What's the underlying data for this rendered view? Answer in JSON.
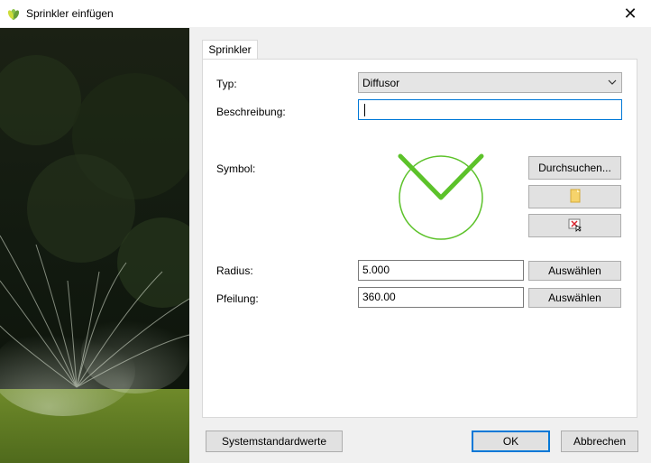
{
  "window": {
    "title": "Sprinkler einfügen",
    "close_glyph": "✕",
    "app_icon": "sprinkler-leaf-icon"
  },
  "tabs": [
    {
      "label": "Sprinkler",
      "active": true
    }
  ],
  "form": {
    "type_label": "Typ:",
    "type_value": "Diffusor",
    "description_label": "Beschreibung:",
    "description_value": "",
    "symbol_label": "Symbol:",
    "browse_label": "Durchsuchen...",
    "open_icon": "folder-file-icon",
    "clear_icon": "remove-image-icon",
    "radius_label": "Radius:",
    "radius_value": "5.000",
    "bearing_label": "Pfeilung:",
    "bearing_value": "360.00",
    "select_label": "Auswählen"
  },
  "footer": {
    "defaults_label": "Systemstandardwerte",
    "ok_label": "OK",
    "cancel_label": "Abbrechen"
  },
  "colors": {
    "symbol_green": "#5cc22a",
    "focus_blue": "#0078d7"
  }
}
